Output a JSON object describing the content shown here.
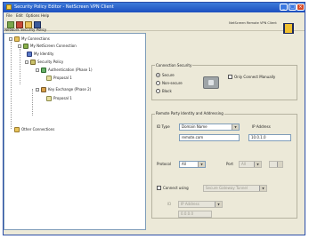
{
  "window": {
    "title": "Security Policy Editor - NetScreen VPN Client"
  },
  "menu": [
    "File",
    "Edit",
    "Options",
    "Help"
  ],
  "tree": {
    "header": "Network Security Policy",
    "nodes": [
      "My Connections",
      "My NetScreen Connection",
      "My Identity",
      "Security Policy",
      "Authentication (Phase 1)",
      "Proposal 1",
      "Key Exchange (Phase 2)",
      "Proposal 1",
      "Other Connections"
    ]
  },
  "logo": {
    "caption": "NetScreen Remote VPN Client"
  },
  "connection_security": {
    "title": "Connection Security",
    "options": [
      "Secure",
      "Non-secure",
      "Block"
    ],
    "selected": "Secure",
    "only_connect_manually": "Only Connect Manually"
  },
  "remote_party": {
    "title": "Remote Party Identity and Addressing",
    "id_type_label": "ID Type",
    "id_type_value": "Domain Name",
    "ip_address_label": "IP Address",
    "domain_value": "remote.com",
    "ip_value": "10.0.1.0",
    "protocol_label": "Protocol",
    "protocol_value": "All",
    "port_label": "Port",
    "port_value": "All",
    "connect_using_label": "Connect using",
    "connect_using_value": "Secure Gateway Tunnel",
    "id_label": "ID",
    "id_value": "IP Address",
    "gateway_value": "0.0.0.0"
  }
}
